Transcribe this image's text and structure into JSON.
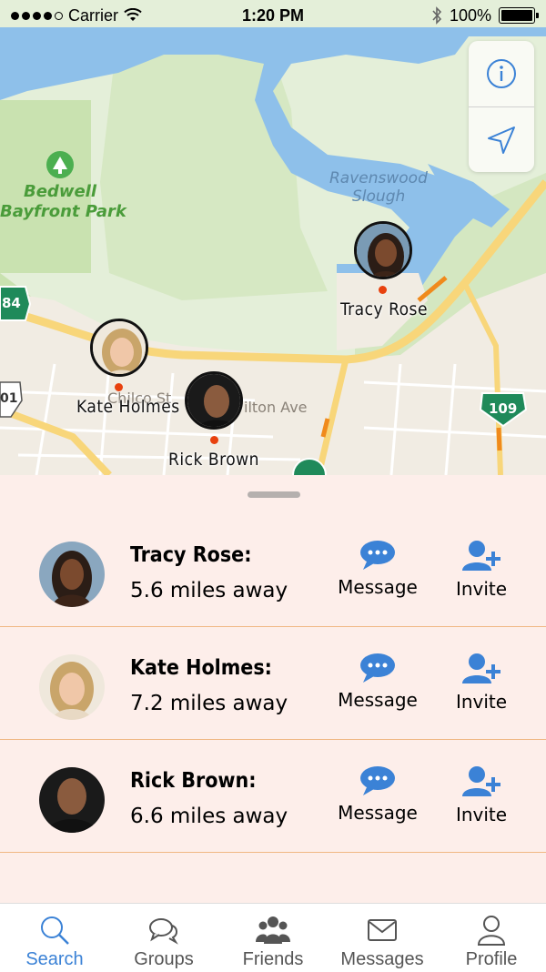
{
  "status_bar": {
    "carrier": "Carrier",
    "time": "1:20 PM",
    "battery": "100%"
  },
  "map": {
    "place_labels": {
      "park_line1": "Bedwell",
      "park_line2": "Bayfront Park",
      "slough_line1": "Ravenswood",
      "slough_line2": "Slough",
      "street": "Chilco St",
      "avenue": "ilton Ave",
      "shield_84": "84",
      "shield_101": "01",
      "shield_109": "109"
    },
    "pins": [
      {
        "name": "Tracy Rose"
      },
      {
        "name": "Kate Holmes"
      },
      {
        "name": "Rick Brown"
      }
    ],
    "colors": {
      "land": "#e4efd9",
      "park": "#c9e2b0",
      "water": "#7fb6e6",
      "road": "#f8d67a",
      "urban": "#f1ece3",
      "pin_dot": "#e8410e"
    }
  },
  "nearby": [
    {
      "name": "Tracy Rose:",
      "distance": "5.6 miles away",
      "message_label": "Message",
      "invite_label": "Invite"
    },
    {
      "name": "Kate Holmes:",
      "distance": "7.2 miles away",
      "message_label": "Message",
      "invite_label": "Invite"
    },
    {
      "name": "Rick Brown:",
      "distance": "6.6 miles away",
      "message_label": "Message",
      "invite_label": "Invite"
    }
  ],
  "tabs": [
    {
      "label": "Search",
      "icon": "search-icon",
      "active": true
    },
    {
      "label": "Groups",
      "icon": "chat-bubbles-icon",
      "active": false
    },
    {
      "label": "Friends",
      "icon": "people-icon",
      "active": false
    },
    {
      "label": "Messages",
      "icon": "envelope-icon",
      "active": false
    },
    {
      "label": "Profile",
      "icon": "person-icon",
      "active": false
    }
  ],
  "accent_color": "#3b82d6"
}
